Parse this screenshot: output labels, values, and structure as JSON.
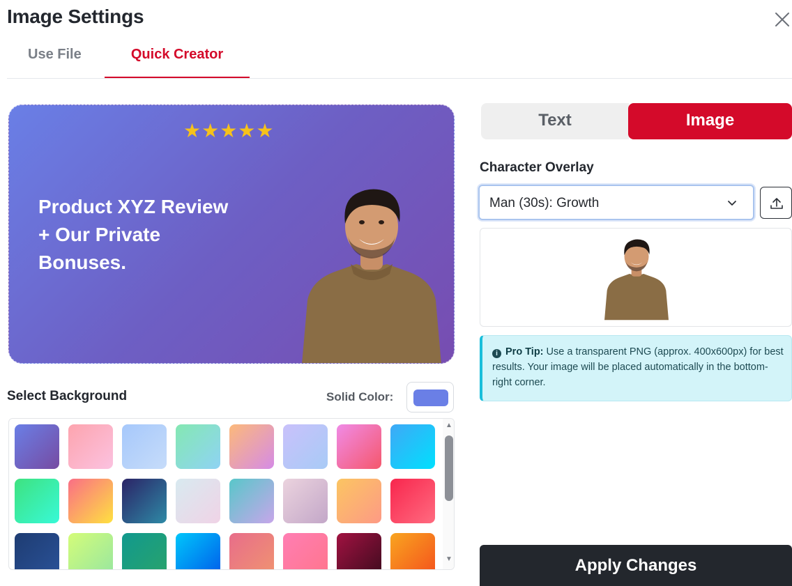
{
  "modal": {
    "title": "Image Settings"
  },
  "tabs": [
    {
      "label": "Use File"
    },
    {
      "label": "Quick Creator",
      "active": true
    }
  ],
  "preview": {
    "stars": "★★★★★",
    "headline_line1": "Product XYZ Review",
    "headline_line2": "+ Our Private",
    "headline_line3": "Bonuses."
  },
  "background": {
    "label": "Select Background",
    "solid_label": "Solid Color:",
    "solid_color": "#6a7fe6",
    "swatches": [
      "linear-gradient(135deg,#6a7fe6,#764ba2)",
      "linear-gradient(135deg,#fda4ae,#fbc2e0)",
      "linear-gradient(135deg,#a6c8fb,#c6dcfa)",
      "linear-gradient(135deg,#84e8b2,#8fd3f4)",
      "linear-gradient(135deg,#fcb97a,#d58be6)",
      "linear-gradient(135deg,#c9c1fb,#a8cbf6)",
      "linear-gradient(135deg,#f08be6,#f5576c)",
      "linear-gradient(135deg,#3fa8f6,#00e0fe)",
      "linear-gradient(135deg,#3ee27f,#38f9d7)",
      "linear-gradient(135deg,#fa6e86,#fee140)",
      "linear-gradient(135deg,#2b2366,#2e8aa6)",
      "linear-gradient(135deg,#d8eaf0,#f0d3e6)",
      "linear-gradient(135deg,#58c7c9,#c7a6ea)",
      "linear-gradient(135deg,#ebd3de,#c3a7c8)",
      "linear-gradient(135deg,#fbc562,#fd9a85)",
      "linear-gradient(135deg,#f8264d,#ff6b80)",
      "linear-gradient(135deg,#1e3c72,#2a5298)",
      "linear-gradient(135deg,#d4fc79,#96e6a1)",
      "linear-gradient(135deg,#11998e,#29a36b)",
      "linear-gradient(135deg,#00c6fb,#005bea)",
      "linear-gradient(135deg,#e86d8a,#f09470)",
      "linear-gradient(135deg,#ff7eb3,#ff758c)",
      "linear-gradient(135deg,#a11241,#3d0b1e)",
      "linear-gradient(135deg,#f9a520,#f4501c)"
    ]
  },
  "panel": {
    "seg_text": "Text",
    "seg_image": "Image",
    "overlay_label": "Character Overlay",
    "overlay_value": "Man (30s): Growth",
    "tip_bold": "Pro Tip:",
    "tip_text": " Use a transparent PNG (approx. 400x600px) for best results. Your image will be placed automatically in the bottom-right corner.",
    "apply_label": "Apply Changes"
  }
}
